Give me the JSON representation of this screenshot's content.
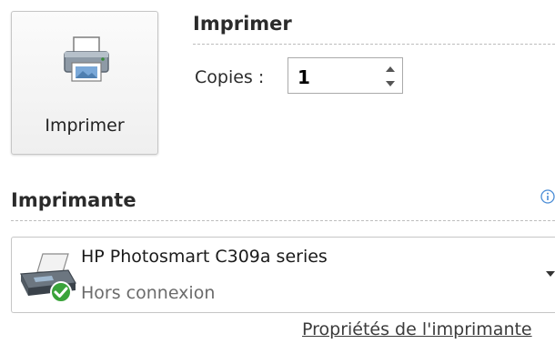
{
  "print_button": {
    "label": "Imprimer",
    "icon": "printer-icon"
  },
  "print_section": {
    "title": "Imprimer",
    "copies_label": "Copies :",
    "copies_value": "1"
  },
  "printer_section": {
    "title": "Imprimante",
    "info_icon": "info-icon",
    "selected_printer": {
      "name": "HP Photosmart C309a series",
      "status": "Hors connexion",
      "icon": "printer-offline-icon",
      "status_badge_icon": "green-check-icon"
    },
    "properties_link": "Propriétés de l'imprimante"
  },
  "colors": {
    "check_green": "#3aa33a",
    "info_blue": "#4a8cd6"
  }
}
